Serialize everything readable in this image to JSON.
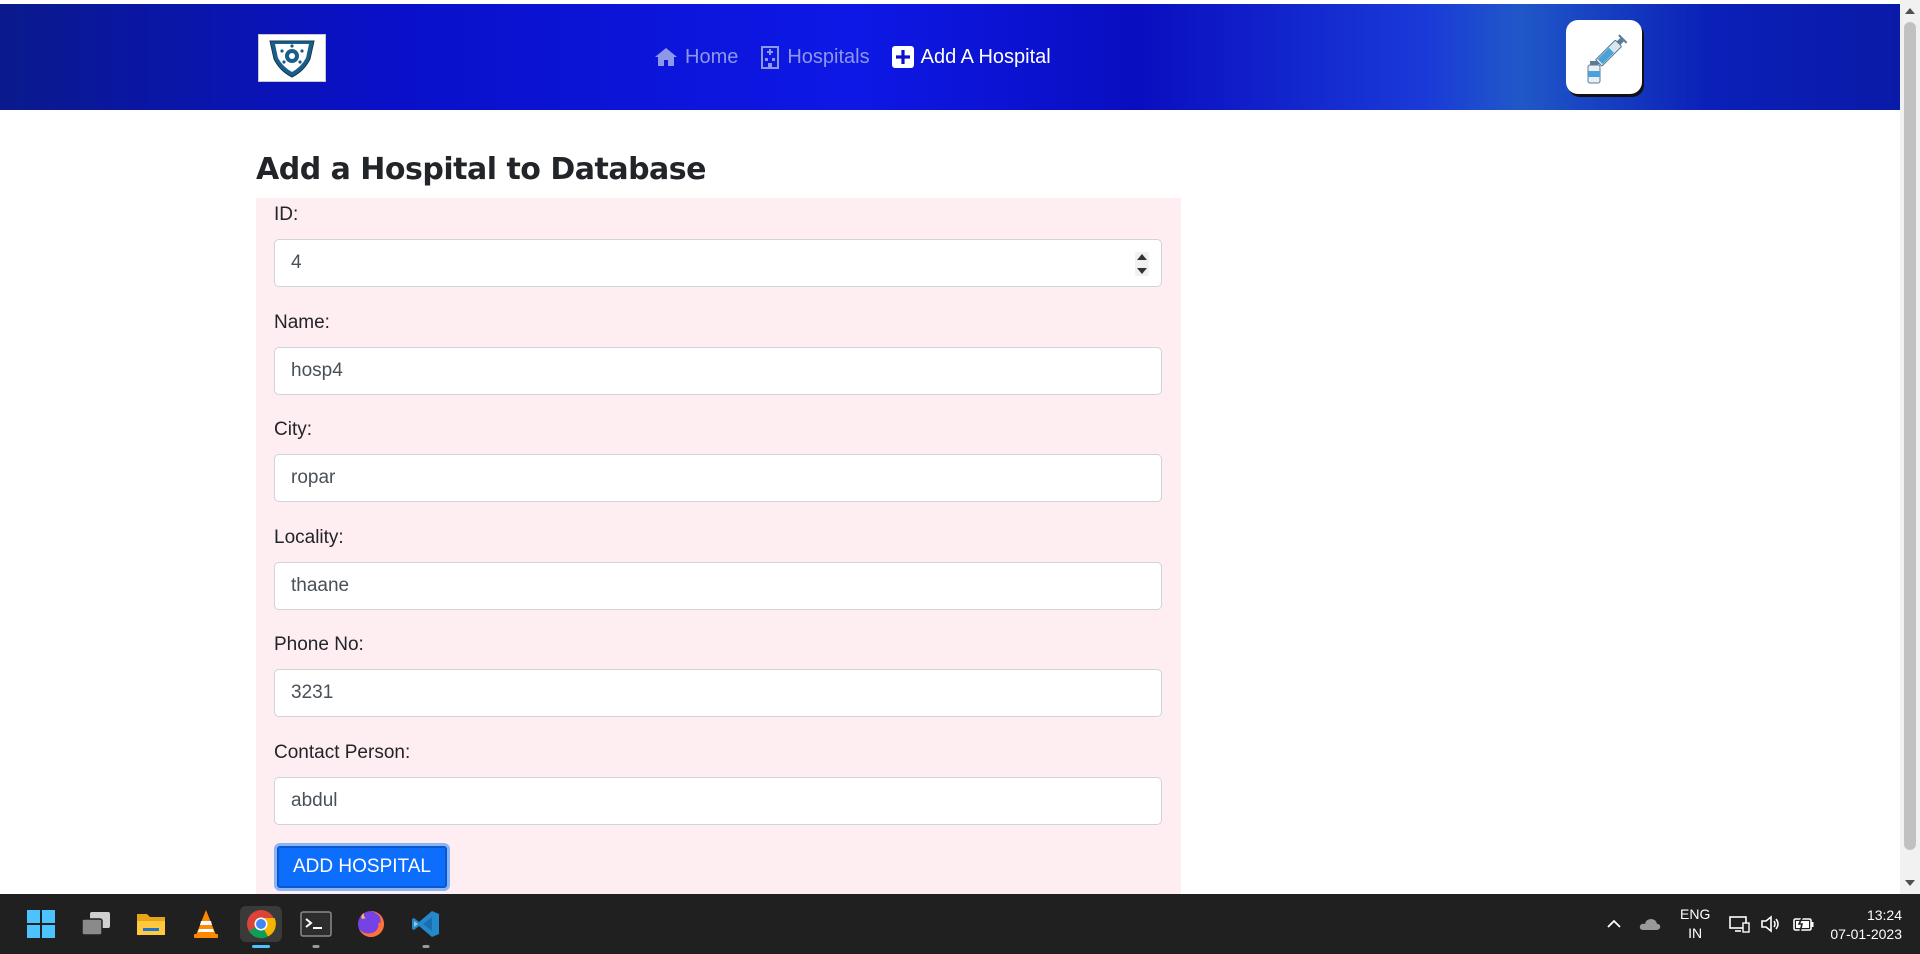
{
  "nav": {
    "home_label": "Home",
    "hospitals_label": "Hospitals",
    "add_label": "Add A Hospital"
  },
  "page": {
    "title": "Add a Hospital to Database"
  },
  "form": {
    "id_label": "ID:",
    "id_value": "4",
    "name_label": "Name:",
    "name_value": "hosp4",
    "city_label": "City:",
    "city_value": "ropar",
    "locality_label": "Locality:",
    "locality_value": "thaane",
    "phone_label": "Phone No:",
    "phone_value": "3231",
    "contact_label": "Contact Person:",
    "contact_value": "abdul",
    "submit_label": "ADD HOSPITAL"
  },
  "taskbar": {
    "apps": [
      "start-icon",
      "task-view-icon",
      "file-explorer-icon",
      "vlc-icon",
      "chrome-icon",
      "terminal-icon",
      "firefox-icon",
      "vscode-icon"
    ],
    "lang_line1": "ENG",
    "lang_line2": "IN",
    "time": "13:24",
    "date": "07-01-2023"
  },
  "colors": {
    "nav_gradient_main": "#0a10c8",
    "form_bg": "#ffeef1",
    "primary_button": "#0d6efd"
  }
}
